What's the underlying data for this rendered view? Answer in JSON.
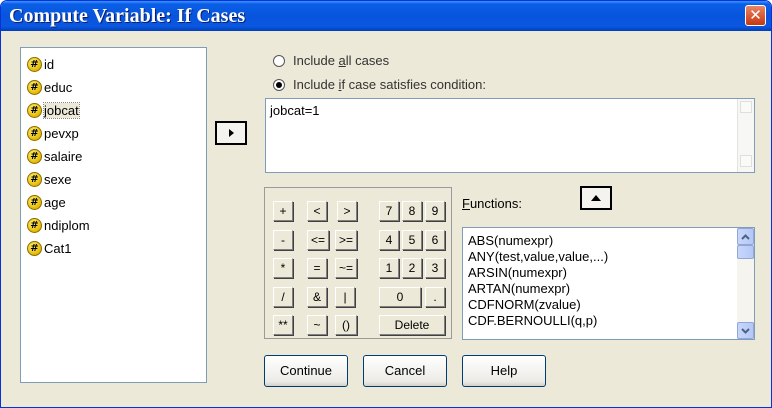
{
  "window": {
    "title": "Compute Variable: If Cases",
    "close_glyph": "✕"
  },
  "variables": [
    {
      "label": "id",
      "icon": "numeric-variable-icon"
    },
    {
      "label": "educ",
      "icon": "numeric-variable-icon"
    },
    {
      "label": "jobcat",
      "icon": "numeric-variable-icon",
      "selected": true
    },
    {
      "label": "pevxp",
      "icon": "numeric-variable-icon"
    },
    {
      "label": "salaire",
      "icon": "numeric-variable-icon"
    },
    {
      "label": "sexe",
      "icon": "numeric-variable-icon"
    },
    {
      "label": "age",
      "icon": "numeric-variable-icon"
    },
    {
      "label": "ndiplom",
      "icon": "numeric-variable-icon"
    },
    {
      "label": "Cat1",
      "icon": "numeric-variable-icon"
    }
  ],
  "radio": {
    "all_cases_pre": "Include ",
    "all_cases_u": "a",
    "all_cases_post": "ll cases",
    "if_pre": "Include ",
    "if_u": "i",
    "if_post": "f case satisfies condition:"
  },
  "condition": {
    "value": "jobcat=1"
  },
  "keypad": {
    "keys": [
      "+",
      "<",
      ">",
      "7",
      "8",
      "9",
      "-",
      "<=",
      ">=",
      "4",
      "5",
      "6",
      "*",
      "=",
      "~=",
      "1",
      "2",
      "3",
      "/",
      "&",
      "|",
      "0",
      ".",
      "**",
      "~",
      "()",
      "Delete"
    ]
  },
  "functions": {
    "label_u": "F",
    "label_rest": "unctions:",
    "items": [
      "ABS(numexpr)",
      "ANY(test,value,value,...)",
      "ARSIN(numexpr)",
      "ARTAN(numexpr)",
      "CDFNORM(zvalue)",
      "CDF.BERNOULLI(q,p)"
    ]
  },
  "buttons": {
    "continue": "Continue",
    "cancel": "Cancel",
    "help": "Help"
  },
  "colors": {
    "titlebar": "#0854dd",
    "dialog_bg": "#ece9d8",
    "close_button": "#c6380f"
  }
}
